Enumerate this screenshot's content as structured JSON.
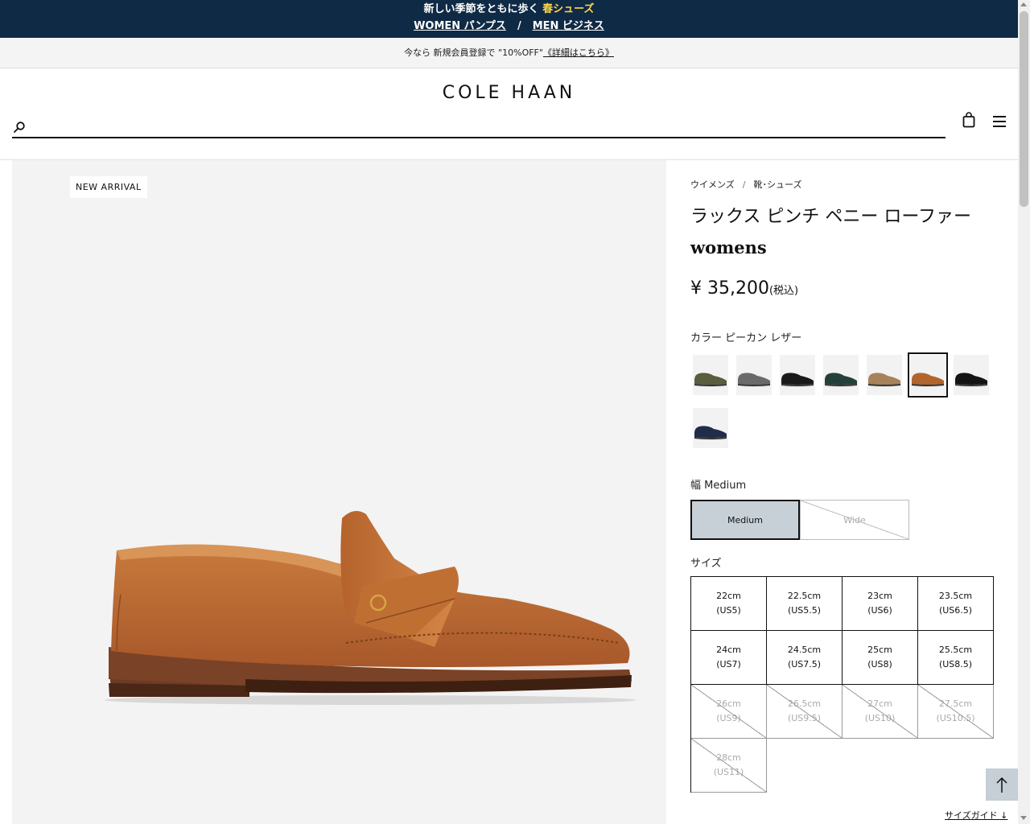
{
  "promo": {
    "line1_text": "新しい季節をともに歩く ",
    "line1_highlight": "春シューズ",
    "women_link": "WOMEN パンプス",
    "separator": "/",
    "men_link": "MEN ビジネス"
  },
  "member": {
    "text": "今なら 新規会員登録で \"10%OFF\"",
    "link": "《詳細はこちら》"
  },
  "header": {
    "logo": "COLE HAAN",
    "search_placeholder": ""
  },
  "gallery": {
    "badge": "NEW ARRIVAL"
  },
  "breadcrumb": {
    "items": [
      "ウイメンズ",
      "靴･シューズ"
    ],
    "separator": "/"
  },
  "product": {
    "title": "ラックス ピンチ ペニー ローファー",
    "subtitle": "womens",
    "price": "¥ 35,200",
    "tax": "(税込)",
    "color_label": "カラー",
    "color_name": "ピーカン レザー",
    "swatches": [
      {
        "name": "olive",
        "color": "#5a5d3e",
        "selected": false
      },
      {
        "name": "houndstooth",
        "color": "#6a6a6a",
        "selected": false
      },
      {
        "name": "black-patent",
        "color": "#1a1a1a",
        "selected": false
      },
      {
        "name": "dark-green",
        "color": "#24403a",
        "selected": false
      },
      {
        "name": "leopard",
        "color": "#a7825a",
        "selected": false
      },
      {
        "name": "pecan",
        "color": "#b2652c",
        "selected": true
      },
      {
        "name": "black",
        "color": "#141414",
        "selected": false
      },
      {
        "name": "navy",
        "color": "#1f2c4a",
        "selected": false
      }
    ],
    "width_label": "幅",
    "width_value": "Medium",
    "width_options": [
      {
        "label": "Medium",
        "selected": true,
        "available": true
      },
      {
        "label": "Wide",
        "selected": false,
        "available": false
      }
    ],
    "size_label": "サイズ",
    "sizes": [
      {
        "cm": "22cm",
        "us": "(US5)",
        "available": true
      },
      {
        "cm": "22.5cm",
        "us": "(US5.5)",
        "available": true
      },
      {
        "cm": "23cm",
        "us": "(US6)",
        "available": true
      },
      {
        "cm": "23.5cm",
        "us": "(US6.5)",
        "available": true
      },
      {
        "cm": "24cm",
        "us": "(US7)",
        "available": true
      },
      {
        "cm": "24.5cm",
        "us": "(US7.5)",
        "available": true
      },
      {
        "cm": "25cm",
        "us": "(US8)",
        "available": true
      },
      {
        "cm": "25.5cm",
        "us": "(US8.5)",
        "available": true
      },
      {
        "cm": "26cm",
        "us": "(US9)",
        "available": false
      },
      {
        "cm": "26.5cm",
        "us": "(US9.5)",
        "available": false
      },
      {
        "cm": "27cm",
        "us": "(US10)",
        "available": false
      },
      {
        "cm": "27.5cm",
        "us": "(US10.5)",
        "available": false
      },
      {
        "cm": "28cm",
        "us": "(US11)",
        "available": false
      }
    ],
    "size_guide": "サイズガイド ↓"
  },
  "colors": {
    "promo_bg": "#0e2a45",
    "highlight": "#ffd54a",
    "selected_bg": "#c7d0d6"
  }
}
